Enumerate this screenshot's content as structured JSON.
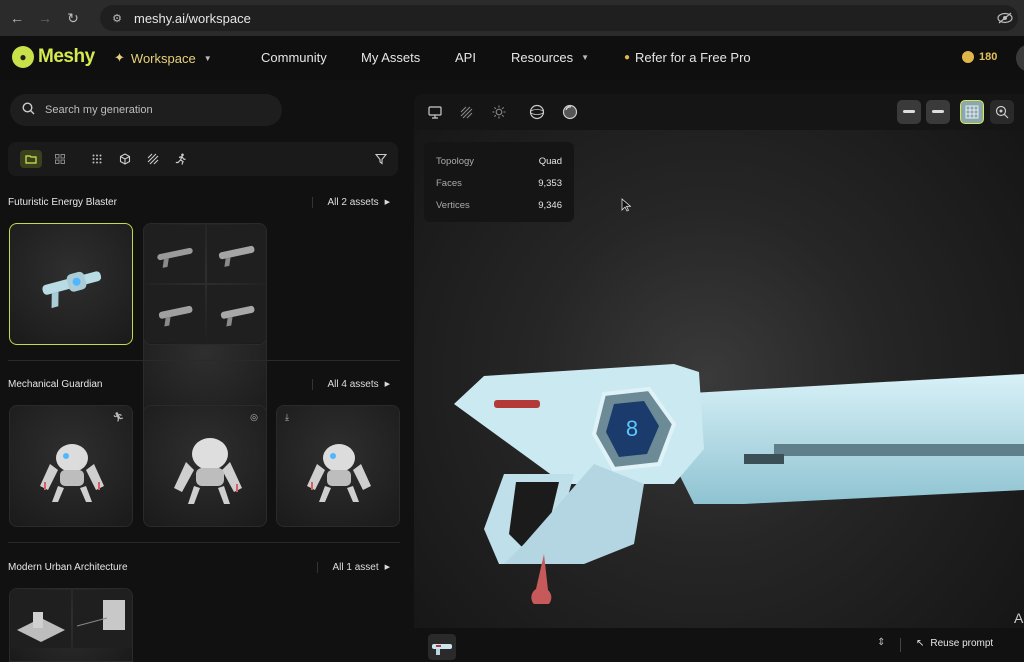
{
  "browser": {
    "url": "meshy.ai/workspace"
  },
  "header": {
    "logo": "Meshy",
    "nav": [
      {
        "label": "Workspace",
        "caret": true
      },
      {
        "label": "Community"
      },
      {
        "label": "My Assets"
      },
      {
        "label": "API"
      },
      {
        "label": "Resources",
        "caret": true
      },
      {
        "label": "Refer for a Free Pro"
      }
    ],
    "credits": "180",
    "accent": "#d6ea4f"
  },
  "left": {
    "search_placeholder": "Search my generation",
    "sections": [
      {
        "title": "Futuristic Energy Blaster",
        "all": "All 2 assets"
      },
      {
        "title": "Mechanical Guardian",
        "all": "All 4 assets"
      },
      {
        "title": "Modern Urban Architecture",
        "all": "All 1 asset"
      }
    ]
  },
  "viewport": {
    "stats": [
      {
        "k": "Topology",
        "v": "Quad"
      },
      {
        "k": "Faces",
        "v": "9,353"
      },
      {
        "k": "Vertices",
        "v": "9,346"
      }
    ],
    "reuse_label": "Reuse prompt",
    "side_text": "A"
  }
}
